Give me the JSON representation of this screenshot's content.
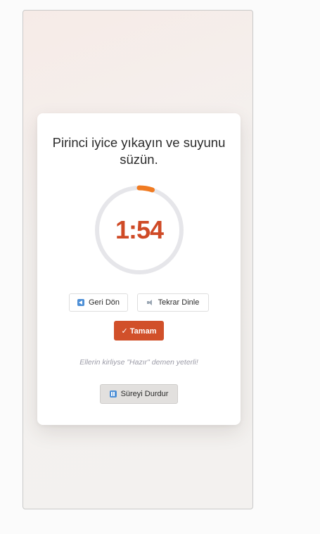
{
  "step": {
    "instruction": "Pirinci iyice yıkayın ve suyunu süzün."
  },
  "timer": {
    "display": "1:54",
    "progress_elapsed_fraction": 0.05,
    "accent_color": "#f07b22",
    "track_color": "#e6e6ea",
    "text_color": "#cf4a26"
  },
  "buttons": {
    "back_label": "Geri Dön",
    "replay_label": "Tekrar Dinle",
    "ok_label": "✓ Tamam",
    "pause_label": "Süreyi Durdur"
  },
  "hint": "Ellerin kirliyse \"Hazır\" demen yeterli!",
  "colors": {
    "primary": "#d1502a",
    "icon_blue": "#4d8fd6"
  },
  "icons": {
    "back": "back-arrow-icon",
    "replay": "speaker-icon",
    "pause": "pause-icon"
  }
}
